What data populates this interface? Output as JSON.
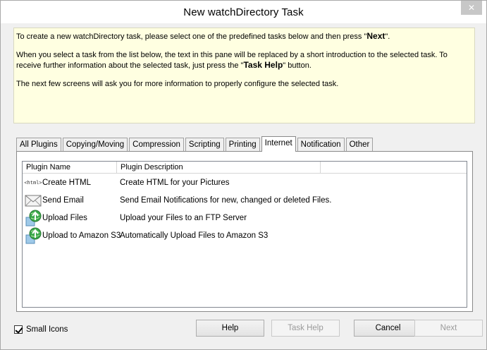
{
  "window": {
    "title": "New watchDirectory Task",
    "close_glyph": "✕"
  },
  "intro": {
    "p1_pre": "To create a new watchDirectory task, please select one of the predefined tasks below and then press \"",
    "p1_bold": "Next",
    "p1_post": "\".",
    "p2_pre": "When you select a task from the list below, the text in this pane will be replaced by a short introduction to the selected task. To receive further information about the selected task, just press the \"",
    "p2_bold": "Task Help",
    "p2_post": "\" button.",
    "p3": "The next few screens will ask you for more information to properly configure the selected task."
  },
  "tabs": [
    {
      "label": "All Plugins"
    },
    {
      "label": "Copying/Moving"
    },
    {
      "label": "Compression"
    },
    {
      "label": "Scripting"
    },
    {
      "label": "Printing"
    },
    {
      "label": "Internet",
      "active": true
    },
    {
      "label": "Notification"
    },
    {
      "label": "Other"
    }
  ],
  "list": {
    "columns": [
      "Plugin Name",
      "Plugin Description"
    ],
    "rows": [
      {
        "name": "Create HTML",
        "desc": "Create HTML for your Pictures",
        "icon": "html-icon",
        "icon_text": "<html>"
      },
      {
        "name": "Send Email",
        "desc": "Send Email Notifications for new, changed or deleted Files.",
        "icon": "envelope-icon"
      },
      {
        "name": "Upload Files",
        "desc": "Upload your Files to an FTP Server",
        "icon": "globe-upload-icon"
      },
      {
        "name": "Upload to Amazon S3",
        "desc": "Automatically Upload Files to Amazon S3",
        "icon": "globe-upload-icon"
      }
    ]
  },
  "footer": {
    "small_icons_label": "Small Icons",
    "help_label": "Help",
    "task_help_label": "Task Help",
    "cancel_label": "Cancel",
    "next_label": "Next"
  }
}
